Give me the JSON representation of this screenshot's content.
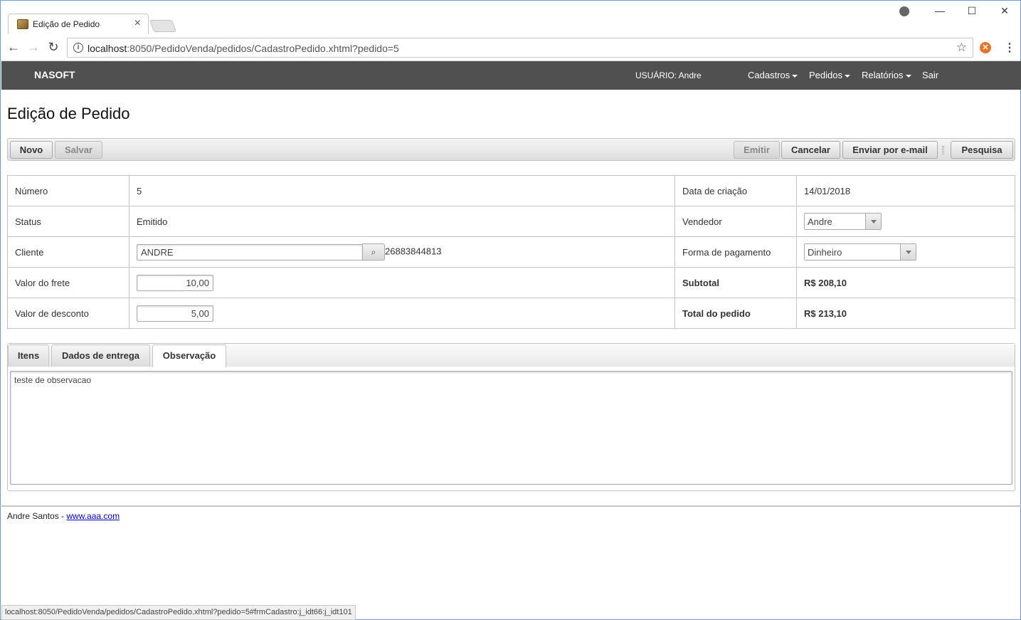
{
  "browser": {
    "tab_title": "Edição de Pedido",
    "url_host": "localhost",
    "url_rest": ":8050/PedidoVenda/pedidos/CadastroPedido.xhtml?pedido=5",
    "status_url": "localhost:8050/PedidoVenda/pedidos/CadastroPedido.xhtml?pedido=5#frmCadastro:j_idt66:j_idt101"
  },
  "nav": {
    "brand": "NASOFT",
    "user": "USUÁRIO: Andre",
    "items": [
      "Cadastros",
      "Pedidos",
      "Relatórios"
    ],
    "logout": "Sair"
  },
  "page": {
    "title": "Edição de Pedido"
  },
  "buttons": {
    "novo": "Novo",
    "salvar": "Salvar",
    "emitir": "Emitir",
    "cancelar": "Cancelar",
    "enviar_email": "Enviar por e-mail",
    "pesquisa": "Pesquisa"
  },
  "form": {
    "numero_label": "Número",
    "numero": "5",
    "data_criacao_label": "Data de criação",
    "data_criacao": "14/01/2018",
    "status_label": "Status",
    "status": "Emitido",
    "vendedor_label": "Vendedor",
    "vendedor": "Andre",
    "cliente_label": "Cliente",
    "cliente": "ANDRE",
    "cliente_doc": "26883844813",
    "forma_pagamento_label": "Forma de pagamento",
    "forma_pagamento": "Dinheiro",
    "valor_frete_label": "Valor do frete",
    "valor_frete": "10,00",
    "subtotal_label": "Subtotal",
    "subtotal": "R$ 208,10",
    "valor_desconto_label": "Valor de desconto",
    "valor_desconto": "5,00",
    "total_label": "Total do pedido",
    "total": "R$ 213,10"
  },
  "tabs": {
    "items": [
      "Itens",
      "Dados de entrega",
      "Observação"
    ],
    "active": "Observação",
    "observacao": "teste de observacao"
  },
  "footer": {
    "text": "Andre Santos - ",
    "link": "www.aaa.com"
  }
}
